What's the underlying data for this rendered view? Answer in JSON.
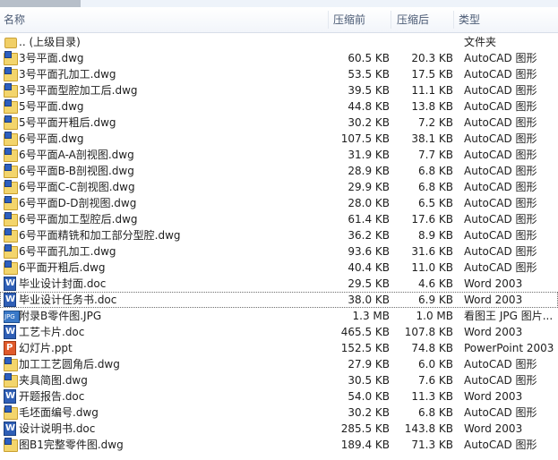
{
  "columns": {
    "name": "名称",
    "size_before": "压缩前",
    "size_after": "压缩后",
    "type": "类型"
  },
  "files": [
    {
      "name": ".. (上级目录)",
      "before": "",
      "after": "",
      "type": "文件夹",
      "icon": "folder-icon"
    },
    {
      "name": "3号平面.dwg",
      "before": "60.5 KB",
      "after": "20.3 KB",
      "type": "AutoCAD 图形",
      "icon": "dwg-file-icon"
    },
    {
      "name": "3号平面孔加工.dwg",
      "before": "53.5 KB",
      "after": "17.5 KB",
      "type": "AutoCAD 图形",
      "icon": "dwg-file-icon"
    },
    {
      "name": "3号平面型腔加工后.dwg",
      "before": "39.5 KB",
      "after": "11.1 KB",
      "type": "AutoCAD 图形",
      "icon": "dwg-file-icon"
    },
    {
      "name": "5号平面.dwg",
      "before": "44.8 KB",
      "after": "13.8 KB",
      "type": "AutoCAD 图形",
      "icon": "dwg-file-icon"
    },
    {
      "name": "5号平面开粗后.dwg",
      "before": "30.2 KB",
      "after": "7.2 KB",
      "type": "AutoCAD 图形",
      "icon": "dwg-file-icon"
    },
    {
      "name": "6号平面.dwg",
      "before": "107.5 KB",
      "after": "38.1 KB",
      "type": "AutoCAD 图形",
      "icon": "dwg-file-icon"
    },
    {
      "name": "6号平面A-A剖视图.dwg",
      "before": "31.9 KB",
      "after": "7.7 KB",
      "type": "AutoCAD 图形",
      "icon": "dwg-file-icon"
    },
    {
      "name": "6号平面B-B剖视图.dwg",
      "before": "28.9 KB",
      "after": "6.8 KB",
      "type": "AutoCAD 图形",
      "icon": "dwg-file-icon"
    },
    {
      "name": "6号平面C-C剖视图.dwg",
      "before": "29.9 KB",
      "after": "6.8 KB",
      "type": "AutoCAD 图形",
      "icon": "dwg-file-icon"
    },
    {
      "name": "6号平面D-D剖视图.dwg",
      "before": "28.0 KB",
      "after": "6.5 KB",
      "type": "AutoCAD 图形",
      "icon": "dwg-file-icon"
    },
    {
      "name": "6号平面加工型腔后.dwg",
      "before": "61.4 KB",
      "after": "17.6 KB",
      "type": "AutoCAD 图形",
      "icon": "dwg-file-icon"
    },
    {
      "name": "6号平面精铣和加工部分型腔.dwg",
      "before": "36.2 KB",
      "after": "8.9 KB",
      "type": "AutoCAD 图形",
      "icon": "dwg-file-icon"
    },
    {
      "name": "6号平面孔加工.dwg",
      "before": "93.6 KB",
      "after": "31.6 KB",
      "type": "AutoCAD 图形",
      "icon": "dwg-file-icon"
    },
    {
      "name": "6平面开粗后.dwg",
      "before": "40.4 KB",
      "after": "11.0 KB",
      "type": "AutoCAD 图形",
      "icon": "dwg-file-icon"
    },
    {
      "name": "毕业设计封面.doc",
      "before": "29.5 KB",
      "after": "4.6 KB",
      "type": "Word 2003",
      "icon": "word-doc-icon"
    },
    {
      "name": "毕业设计任务书.doc",
      "before": "38.0 KB",
      "after": "6.9 KB",
      "type": "Word 2003",
      "icon": "word-doc-icon",
      "selected": true
    },
    {
      "name": "附录B零件图.JPG",
      "before": "1.3 MB",
      "after": "1.0 MB",
      "type": "看图王 JPG 图片...",
      "icon": "jpg-image-icon"
    },
    {
      "name": "工艺卡片.doc",
      "before": "465.5 KB",
      "after": "107.8 KB",
      "type": "Word 2003",
      "icon": "word-doc-icon"
    },
    {
      "name": "幻灯片.ppt",
      "before": "152.5 KB",
      "after": "74.8 KB",
      "type": "PowerPoint 2003",
      "icon": "powerpoint-icon"
    },
    {
      "name": "加工工艺圆角后.dwg",
      "before": "27.9 KB",
      "after": "6.0 KB",
      "type": "AutoCAD 图形",
      "icon": "dwg-file-icon"
    },
    {
      "name": "夹具简图.dwg",
      "before": "30.5 KB",
      "after": "7.6 KB",
      "type": "AutoCAD 图形",
      "icon": "dwg-file-icon"
    },
    {
      "name": "开题报告.doc",
      "before": "54.0 KB",
      "after": "11.3 KB",
      "type": "Word 2003",
      "icon": "word-doc-icon"
    },
    {
      "name": "毛坯面编号.dwg",
      "before": "30.2 KB",
      "after": "6.8 KB",
      "type": "AutoCAD 图形",
      "icon": "dwg-file-icon"
    },
    {
      "name": "设计说明书.doc",
      "before": "285.5 KB",
      "after": "143.8 KB",
      "type": "Word 2003",
      "icon": "word-doc-icon"
    },
    {
      "name": "图B1完整零件图.dwg",
      "before": "189.4 KB",
      "after": "71.3 KB",
      "type": "AutoCAD 图形",
      "icon": "dwg-file-icon"
    }
  ]
}
